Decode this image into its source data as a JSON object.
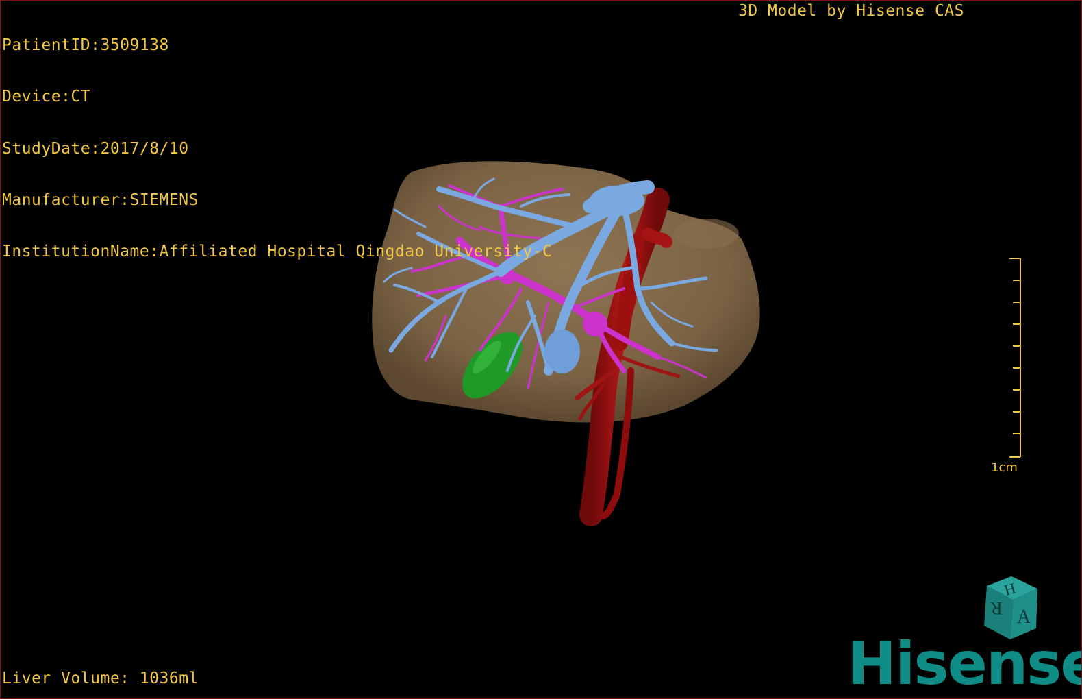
{
  "patient_info": [
    "PatientID:3509138",
    "Device:CT",
    "StudyDate:2017/8/10",
    "Manufacturer:SIEMENS",
    "InstitutionName:Affiliated Hospital Qingdao University-C"
  ],
  "credit": "3D Model by Hisense CAS",
  "liver_volume": "Liver Volume: 1036ml",
  "scale": {
    "label": "1cm",
    "ticks": 10
  },
  "orientation_cube": {
    "face_top": "H",
    "face_front": "A",
    "face_side": "R",
    "color": "#1f8f8a"
  },
  "brand": "Hisense",
  "colors": {
    "overlay_text": "#f2c744",
    "liver": "#7d6547",
    "hepatic_vein": "#7aa8e0",
    "portal_vein": "#cc33cc",
    "ivc_artery": "#a31212",
    "gallbladder": "#1e9a24",
    "brand": "#0f8c86"
  },
  "model_parts": [
    "liver-surface",
    "hepatic-vein",
    "portal-vein",
    "inferior-vena-cava",
    "gallbladder"
  ]
}
